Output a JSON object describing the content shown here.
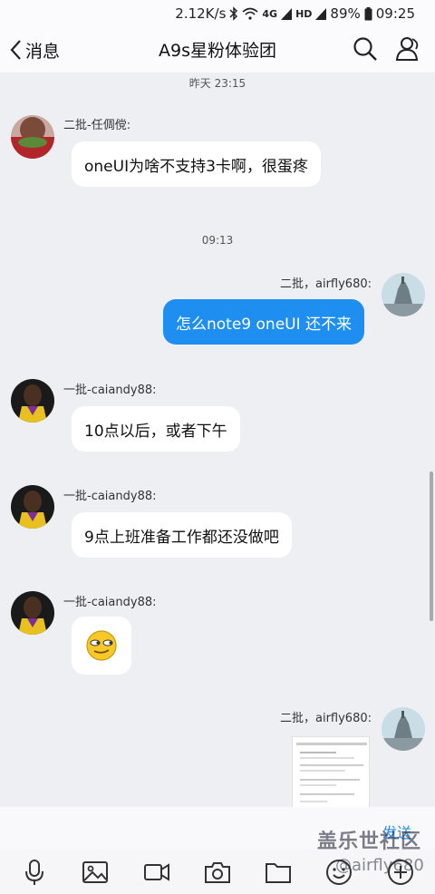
{
  "status_bar": {
    "speed": "2.12K/s",
    "network_top": "4G",
    "network_label": "HD",
    "battery": "89%",
    "time": "09:25"
  },
  "header": {
    "back_label": "消息",
    "title": "A9s星粉体验团"
  },
  "messages": {
    "ts1": "昨天 23:15",
    "m1_sender": "二批-任倜傥:",
    "m1_text": "oneUI为啥不支持3卡啊，很蛋疼",
    "ts2": "09:13",
    "m2_sender": "二批，airfly680:",
    "m2_text": "怎么note9 oneUI 还不来",
    "m3_sender": "一批-caiandy88:",
    "m3_text": "10点以后，或者下午",
    "m4_sender": "一批-caiandy88:",
    "m4_text": "9点上班准备工作都还没做吧",
    "m5_sender": "一批-caiandy88:",
    "m6_sender": "二批，airfly680:"
  },
  "input": {
    "send_label": "发送"
  },
  "watermark": {
    "logo": "盖乐世社区",
    "handle": "@airfly680"
  },
  "colors": {
    "bubble_out": "#1e8ff0",
    "background": "#eeeff3"
  }
}
